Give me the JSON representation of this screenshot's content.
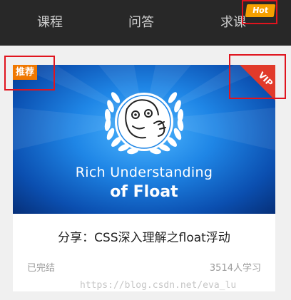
{
  "nav": {
    "tabs": [
      {
        "label": "课程"
      },
      {
        "label": "问答"
      },
      {
        "label": "求课"
      }
    ],
    "hot_badge": "Hot",
    "hot_color": "#f5a000"
  },
  "card": {
    "recommend_badge": "推荐",
    "vip_badge": "VIP",
    "thumbnail": {
      "line1": "Rich Understanding",
      "line2": "of Float",
      "icon": "meme-face-in-laurel-wreath-icon"
    },
    "title": "分享：CSS深入理解之float浮动",
    "status": "已完结",
    "learners": "3514人学习"
  },
  "colors": {
    "nav_bg": "#282828",
    "recommend": "#f07800",
    "vip": "#e13a2a",
    "annotation": "#e0141e"
  },
  "watermark": "https://blog.csdn.net/eva_lu"
}
